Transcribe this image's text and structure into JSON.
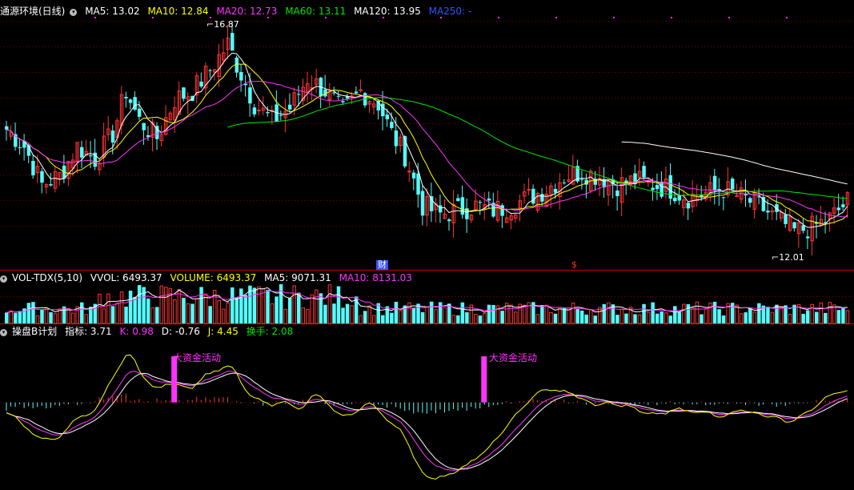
{
  "main": {
    "title": "通源环境(日线)",
    "ma": [
      {
        "label": "MA5: 13.02",
        "color": "#ffffff"
      },
      {
        "label": "MA10: 12.84",
        "color": "#ffff00"
      },
      {
        "label": "MA20: 12.73",
        "color": "#ff33ff"
      },
      {
        "label": "MA60: 13.11",
        "color": "#00e600"
      },
      {
        "label": "MA120: 13.95",
        "color": "#ffffff"
      },
      {
        "label": "MA250: -",
        "color": "#3355ff"
      }
    ],
    "high_label": "16.87",
    "low_label": "12.01",
    "flag_cai": "财",
    "flag_dollar": "$"
  },
  "volume": {
    "name": "VOL-TDX(5,10)",
    "items": [
      {
        "label": "VVOL: 6493.37",
        "color": "#ffffff"
      },
      {
        "label": "VOLUME: 6493.37",
        "color": "#ffff00"
      },
      {
        "label": "MA5: 9071.31",
        "color": "#ffffff"
      },
      {
        "label": "MA10: 8131.03",
        "color": "#ff33ff"
      }
    ]
  },
  "indicator": {
    "name": "操盘B计划",
    "items": [
      {
        "label": "指标: 3.71",
        "color": "#ffffff"
      },
      {
        "label": "K: 0.98",
        "color": "#ff33ff"
      },
      {
        "label": "D: -0.76",
        "color": "#ffffff"
      },
      {
        "label": "J: 4.45",
        "color": "#ffff00"
      },
      {
        "label": "换手: 2.08",
        "color": "#00e600"
      }
    ],
    "signal_label": "大资金活动"
  },
  "colors": {
    "up": "#ff3333",
    "down": "#54fcfc",
    "grid": "#7a0000",
    "ma5": "#ffffff",
    "ma10": "#ffff00",
    "ma20": "#ff33ff",
    "ma60": "#00e600",
    "ma120": "#ffffff"
  },
  "chart_data": {
    "type": "candlestick",
    "price_range": [
      11.4,
      17.4
    ],
    "high": 16.87,
    "low": 12.01,
    "close_anchors": [
      [
        0,
        14.7
      ],
      [
        4,
        14.3
      ],
      [
        8,
        13.4
      ],
      [
        12,
        13.6
      ],
      [
        16,
        14.3
      ],
      [
        20,
        14.0
      ],
      [
        24,
        14.6
      ],
      [
        27,
        15.6
      ],
      [
        30,
        14.9
      ],
      [
        34,
        14.5
      ],
      [
        38,
        15.4
      ],
      [
        42,
        15.6
      ],
      [
        46,
        16.1
      ],
      [
        50,
        16.7
      ],
      [
        53,
        16.0
      ],
      [
        56,
        15.3
      ],
      [
        60,
        14.9
      ],
      [
        64,
        15.2
      ],
      [
        68,
        15.9
      ],
      [
        72,
        15.6
      ],
      [
        76,
        15.1
      ],
      [
        80,
        15.6
      ],
      [
        84,
        15.3
      ],
      [
        87,
        14.6
      ],
      [
        90,
        14.1
      ],
      [
        94,
        12.9
      ],
      [
        98,
        12.7
      ],
      [
        102,
        12.8
      ],
      [
        106,
        12.9
      ],
      [
        110,
        12.8
      ],
      [
        114,
        12.9
      ],
      [
        118,
        13.1
      ],
      [
        122,
        13.3
      ],
      [
        126,
        13.6
      ],
      [
        130,
        13.7
      ],
      [
        134,
        13.6
      ],
      [
        138,
        13.4
      ],
      [
        142,
        13.5
      ],
      [
        146,
        13.4
      ],
      [
        150,
        13.3
      ],
      [
        154,
        13.1
      ],
      [
        158,
        13.2
      ],
      [
        162,
        13.3
      ],
      [
        166,
        13.1
      ],
      [
        170,
        12.9
      ],
      [
        174,
        12.6
      ],
      [
        178,
        12.3
      ],
      [
        182,
        12.4
      ],
      [
        186,
        12.6
      ],
      [
        190,
        13.0
      ]
    ],
    "indicator_anchors": [
      [
        0,
        -5
      ],
      [
        10,
        -15
      ],
      [
        20,
        -5
      ],
      [
        27,
        15
      ],
      [
        33,
        9
      ],
      [
        41,
        7
      ],
      [
        50,
        14
      ],
      [
        58,
        3
      ],
      [
        66,
        -1
      ],
      [
        70,
        2
      ],
      [
        76,
        -4
      ],
      [
        82,
        -2
      ],
      [
        88,
        -8
      ],
      [
        95,
        -27
      ],
      [
        100,
        -30
      ],
      [
        106,
        -26
      ],
      [
        112,
        -16
      ],
      [
        120,
        0
      ],
      [
        126,
        4
      ],
      [
        132,
        1
      ],
      [
        140,
        -1
      ],
      [
        146,
        -4
      ],
      [
        154,
        -3
      ],
      [
        160,
        -5
      ],
      [
        168,
        -4
      ],
      [
        176,
        -7
      ],
      [
        182,
        -4
      ],
      [
        190,
        4
      ]
    ],
    "indicator_range": [
      -38,
      28
    ],
    "signal_days": [
      38,
      108
    ],
    "n_days": 191
  }
}
